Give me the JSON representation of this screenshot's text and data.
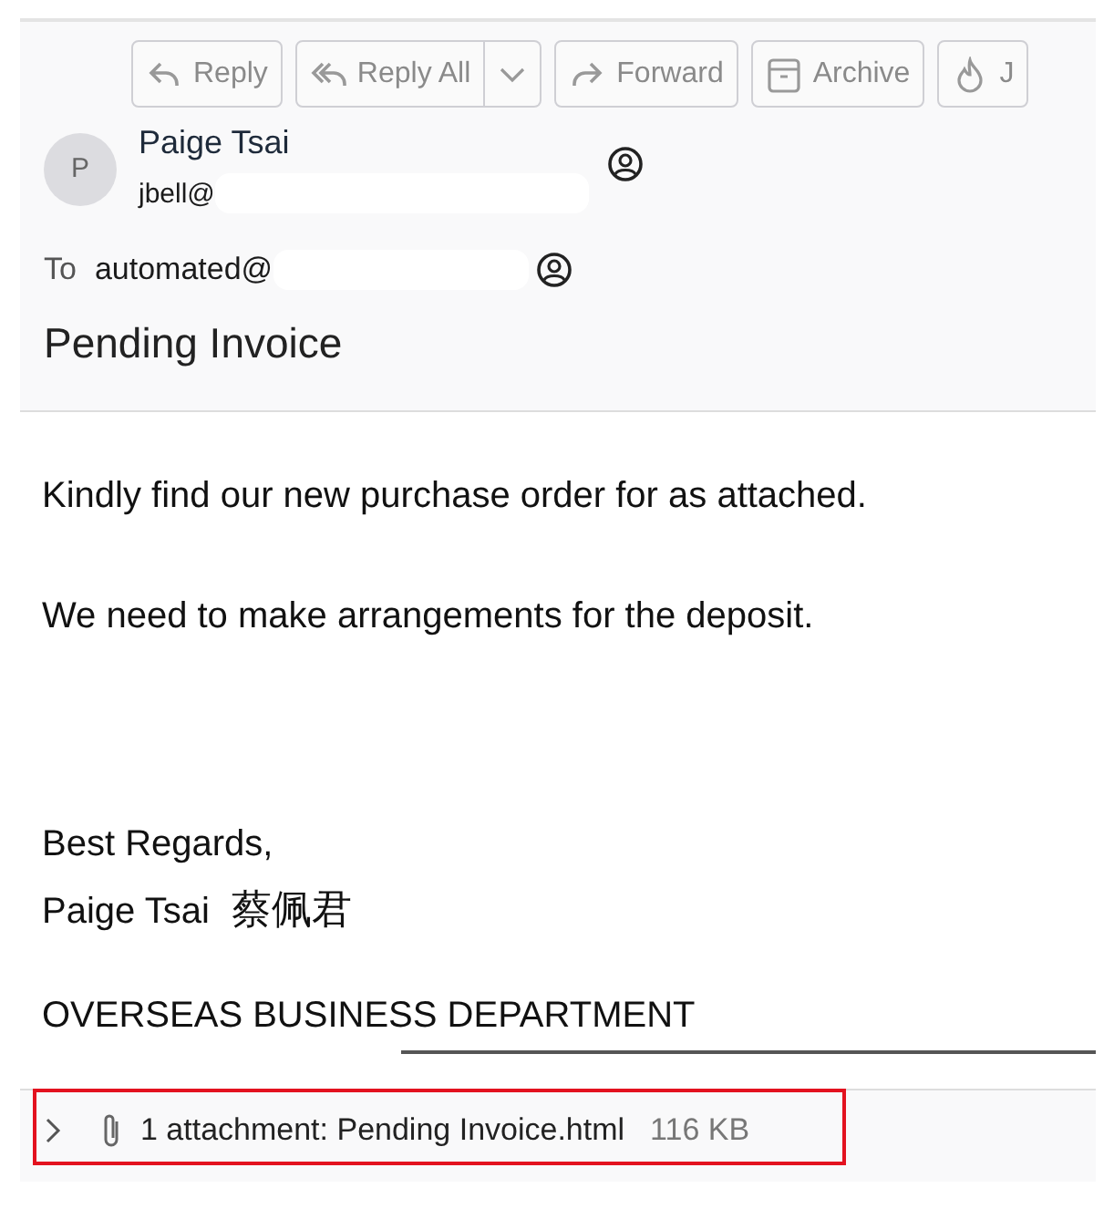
{
  "toolbar": {
    "buttons": [
      {
        "label": "Reply",
        "kind": "reply"
      },
      {
        "label": "Reply All",
        "kind": "reply-all"
      },
      {
        "label": "Forward",
        "kind": "forward"
      },
      {
        "label": "Archive",
        "kind": "archive"
      },
      {
        "label": "J",
        "kind": "junk"
      }
    ]
  },
  "sender": {
    "initial": "P",
    "name": "Paige Tsai",
    "email": "jbell@"
  },
  "recipient": {
    "label": "To",
    "email": "automated@"
  },
  "subject": "Pending Invoice",
  "body": {
    "paragraphs": [
      "Kindly find our new purchase order for as attached.",
      "We need to make arrangements for the deposit."
    ],
    "signature": {
      "closing": "Best Regards,",
      "name": "Paige Tsai",
      "native_name": "蔡佩君"
    },
    "department": "OVERSEAS BUSINESS DEPARTMENT"
  },
  "attachments": {
    "expanded": false,
    "summary": "1 attachment: Pending Invoice.html",
    "size": "116 KB"
  }
}
